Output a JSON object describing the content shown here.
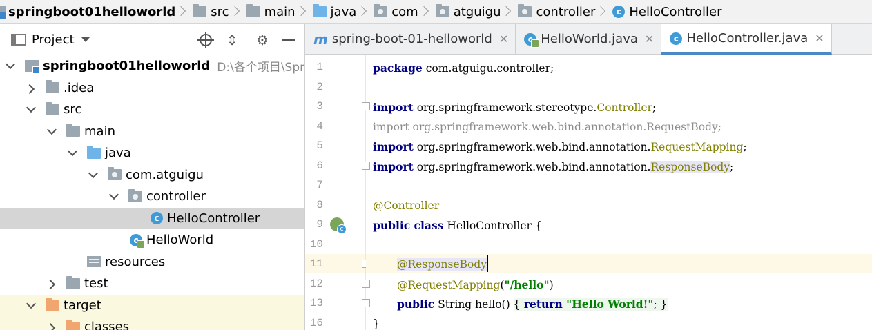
{
  "breadcrumb": [
    {
      "label": "springboot01helloworld",
      "icon": "module-icon"
    },
    {
      "label": "src",
      "icon": "folder-icon"
    },
    {
      "label": "main",
      "icon": "folder-icon"
    },
    {
      "label": "java",
      "icon": "source-folder-icon"
    },
    {
      "label": "com",
      "icon": "package-icon"
    },
    {
      "label": "atguigu",
      "icon": "package-icon"
    },
    {
      "label": "controller",
      "icon": "package-icon"
    },
    {
      "label": "HelloController",
      "icon": "class-icon"
    }
  ],
  "project_panel": {
    "title": "Project",
    "tree": [
      {
        "label": "springboot01helloworld",
        "path": "D:\\各个项目\\Spring",
        "icon": "module-icon"
      },
      {
        "label": ".idea",
        "icon": "folder-icon"
      },
      {
        "label": "src",
        "icon": "folder-icon"
      },
      {
        "label": "main",
        "icon": "folder-icon"
      },
      {
        "label": "java",
        "icon": "source-folder-icon"
      },
      {
        "label": "com.atguigu",
        "icon": "package-icon"
      },
      {
        "label": "controller",
        "icon": "package-icon"
      },
      {
        "label": "HelloController",
        "icon": "class-icon"
      },
      {
        "label": "HelloWorld",
        "icon": "runnable-class-icon"
      },
      {
        "label": "resources",
        "icon": "resources-folder-icon"
      },
      {
        "label": "test",
        "icon": "folder-icon"
      },
      {
        "label": "target",
        "icon": "excluded-folder-icon"
      },
      {
        "label": "classes",
        "icon": "excluded-folder-icon"
      }
    ]
  },
  "tabs": [
    {
      "label": "spring-boot-01-helloworld",
      "icon": "maven-icon"
    },
    {
      "label": "HelloWorld.java",
      "icon": "runnable-class-icon"
    },
    {
      "label": "HelloController.java",
      "icon": "class-icon"
    }
  ],
  "editor": {
    "line_numbers": [
      "1",
      "2",
      "3",
      "4",
      "5",
      "6",
      "7",
      "8",
      "9",
      "10",
      "11",
      "12",
      "13",
      "16"
    ],
    "code": {
      "l1_kw": "package",
      "l1_rest": " com.atguigu.controller;",
      "import_kw": "import",
      "l3_pkg": " org.springframework.stereotype.",
      "l3_cls": "Controller",
      "l4_kw": "import",
      "l4_rest": " org.springframework.web.bind.annotation.RequestBody;",
      "l5_pkg": " org.springframework.web.bind.annotation.",
      "l5_cls": "RequestMapping",
      "l6_pkg": " org.springframework.web.bind.annotation.",
      "l6_cls": "ResponseBody",
      "semicolon": ";",
      "l8_ann": "@Controller",
      "l9_kw": "public class",
      "l9_rest": " HelloController {",
      "l11_ann": "@ResponseBody",
      "l12_ann": "@RequestMapping",
      "l12_open": "(",
      "l12_str": "\"/hello\"",
      "l12_close": ")",
      "l13_kw": "public",
      "l13_mid": " String hello() ",
      "l13_brace_open": "{",
      "l13_return": " return",
      "l13_str": " \"Hello World!\"",
      "l13_semi": ";",
      "l13_brace_close": " }",
      "l16_text": "}"
    }
  }
}
